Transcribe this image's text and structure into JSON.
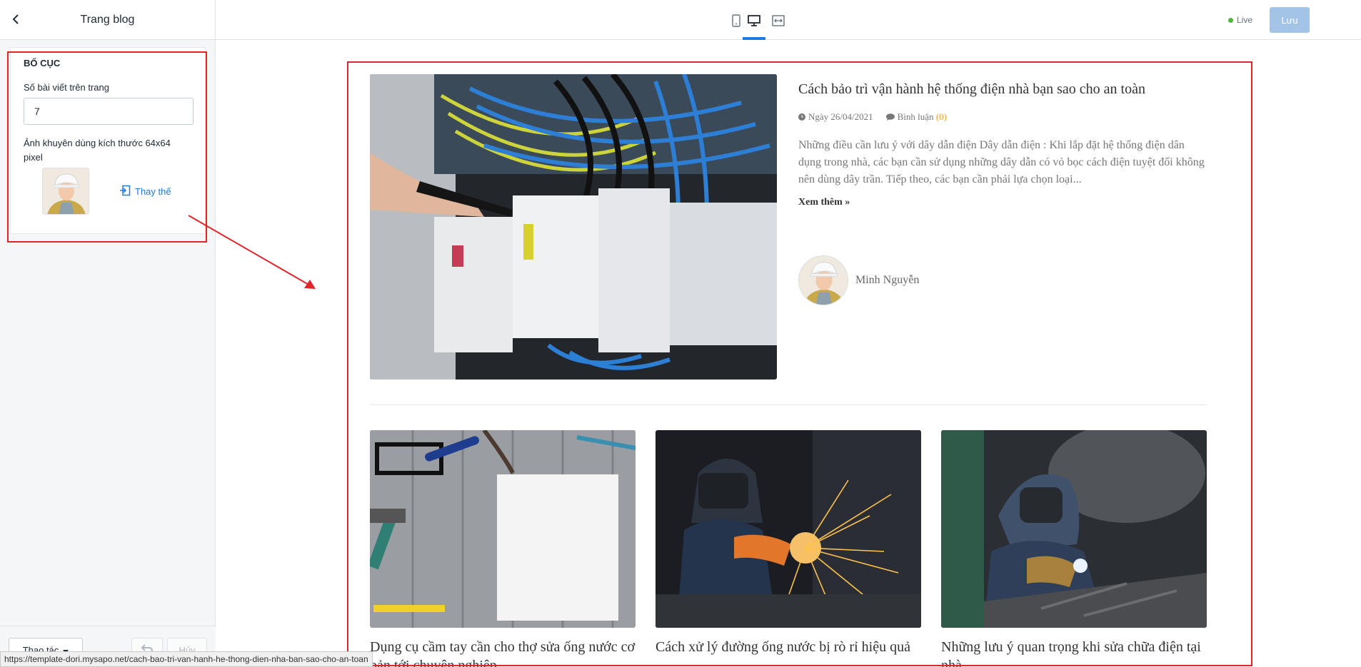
{
  "sidebar": {
    "title": "Trang blog",
    "section_title": "BỐ CỤC",
    "posts_per_page_label": "Số bài viết trên trang",
    "posts_per_page_value": "7",
    "image_hint": "Ảnh khuyên dùng kích thước 64x64 pixel",
    "replace_label": "Thay thế",
    "action_label": "Thao tác",
    "cancel_label": "Hủy"
  },
  "topbar": {
    "live_label": "Live",
    "save_label": "Lưu",
    "active_device": "desktop"
  },
  "featured": {
    "title": "Cách bảo trì vận hành hệ thống điện nhà bạn sao cho an toàn",
    "date": "Ngày 26/04/2021",
    "comments_label": "Bình luận",
    "comments_count": "(0)",
    "excerpt": "Những điều cần lưu ý với dây dẫn điện Dây dẫn điện : Khi lắp đặt hệ thống điện dân dụng trong nhà, các bạn cần sử dụng những dây dẫn có vỏ bọc cách điện tuyệt đối không nên dùng dây trần. Tiếp theo, các bạn cần phải lựa chọn loại...",
    "read_more": "Xem thêm »",
    "author": "Minh Nguyễn"
  },
  "cards": [
    {
      "title": "Dụng cụ cầm tay cần cho thợ sửa ống nước cơ bản tới chuyên nghiệp"
    },
    {
      "title": "Cách xử lý đường ống nước bị rò rỉ hiệu quả"
    },
    {
      "title": "Những lưu ý quan trọng khi sửa chữa điện tại nhà"
    }
  ],
  "status_url": "https://template-dori.mysapo.net/cach-bao-tri-van-hanh-he-thong-dien-nha-ban-sao-cho-an-toan",
  "colors": {
    "accent": "#1f7ae0",
    "annotation": "#e3242b",
    "comment_count": "#e5a12a",
    "live": "#50b83c"
  }
}
